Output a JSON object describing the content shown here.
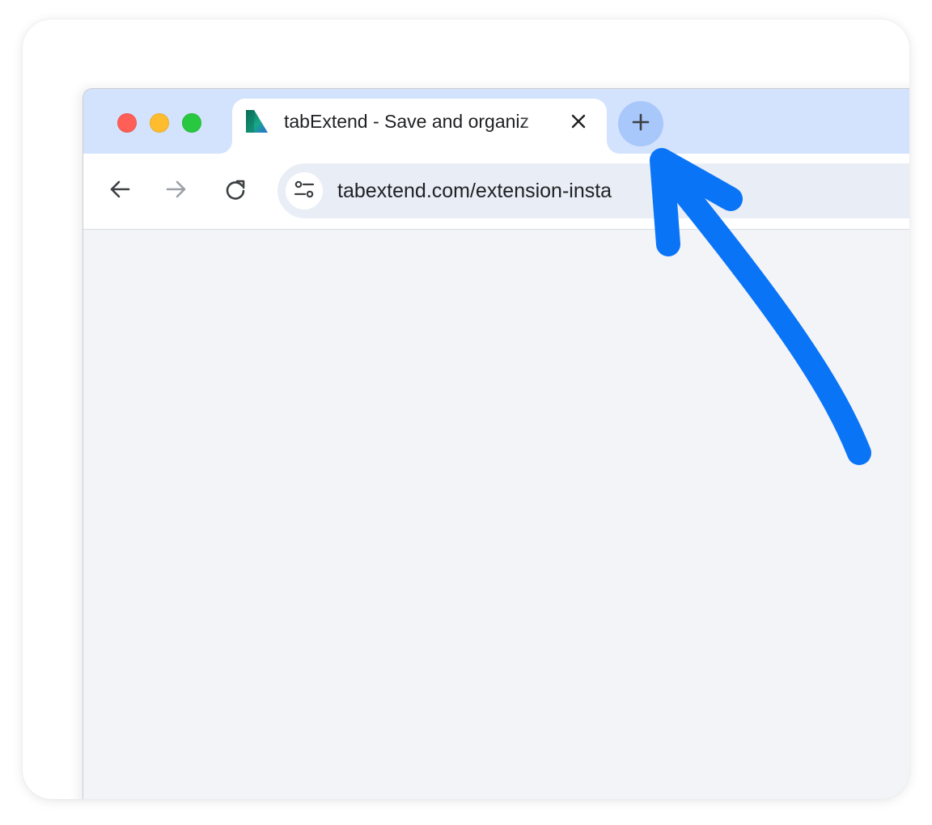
{
  "window": {
    "traffic_lights": {
      "close_color": "#ff5f57",
      "minimize_color": "#febc2e",
      "zoom_color": "#28c840"
    }
  },
  "tab": {
    "title": "tabExtend - Save and organiz",
    "favicon": "tabextend-logo-icon",
    "close_icon": "close-icon"
  },
  "new_tab": {
    "icon": "plus-icon",
    "color": "#a8c7fa"
  },
  "toolbar": {
    "back_icon": "arrow-left-icon",
    "forward_icon": "arrow-right-icon",
    "reload_icon": "reload-icon",
    "site_settings_icon": "tune-icon",
    "url": "tabextend.com/extension-insta"
  },
  "annotation": {
    "type": "hand-drawn arrow pointing to new tab button",
    "color": "#0a74f7"
  },
  "colors": {
    "tabstrip": "#d3e3fd",
    "omnibox": "#e9eef6",
    "content": "#f3f4f7"
  }
}
